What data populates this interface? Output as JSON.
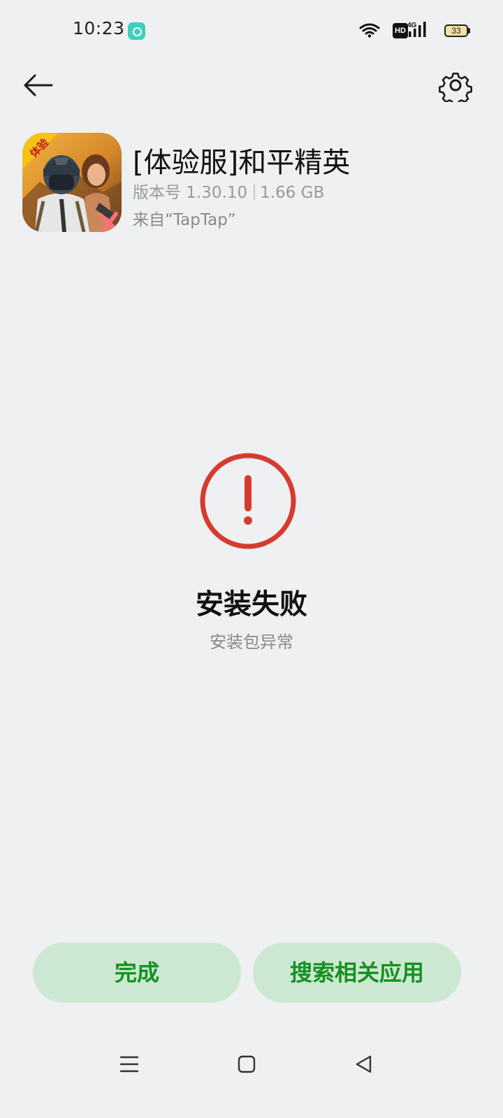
{
  "status_bar": {
    "time": "10:23",
    "hd_label": "HD",
    "network_label": "4G",
    "battery_level": "33"
  },
  "header": {
    "back_icon": "arrow-left-icon",
    "settings_icon": "gear-icon"
  },
  "app": {
    "title": "[体验服]和平精英",
    "version": "版本号 1.30.10",
    "size": "1.66 GB",
    "source": "来自“TapTap”",
    "icon_badge": "体验"
  },
  "result": {
    "icon": "exclamation-circle-icon",
    "title": "安装失败",
    "subtitle": "安装包异常"
  },
  "actions": {
    "done_label": "完成",
    "search_label": "搜索相关应用"
  },
  "colors": {
    "background": "#eff0f2",
    "error": "#d63b2f",
    "button_bg": "#cde8d2",
    "button_text": "#14911f"
  }
}
